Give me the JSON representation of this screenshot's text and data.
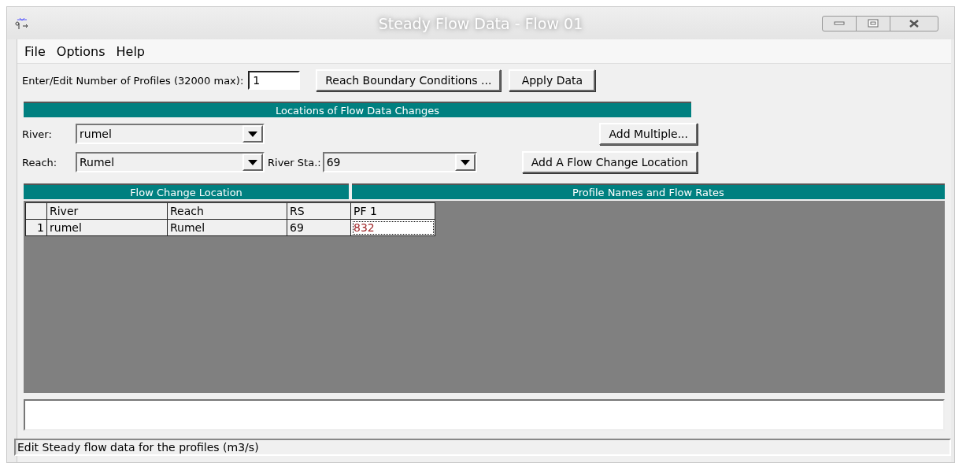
{
  "window": {
    "title": "Steady Flow Data - Flow 01"
  },
  "menu": [
    "File",
    "Options",
    "Help"
  ],
  "profiles": {
    "label": "Enter/Edit Number of Profiles (32000 max):",
    "value": "1"
  },
  "top_buttons": [
    "Reach Boundary Conditions ...",
    "Apply Data"
  ],
  "locations_header": "Locations of Flow Data Changes",
  "river": {
    "label": "River:",
    "value": "rumel"
  },
  "add_multiple": "Add Multiple...",
  "reach": {
    "label": "Reach:",
    "value": "Rumel"
  },
  "river_station": {
    "label": "River Sta.:",
    "value": "69"
  },
  "add_location": "Add A Flow Change Location",
  "table": {
    "group_headers": [
      "Flow Change Location",
      "Profile Names and Flow Rates"
    ],
    "columns": [
      "River",
      "Reach",
      "RS",
      "PF 1"
    ],
    "rows": [
      {
        "number": "1",
        "cells": [
          "rumel",
          "Rumel",
          "69",
          "832"
        ]
      }
    ]
  },
  "status_bar": "Edit Steady flow data for the profiles (m3/s)"
}
